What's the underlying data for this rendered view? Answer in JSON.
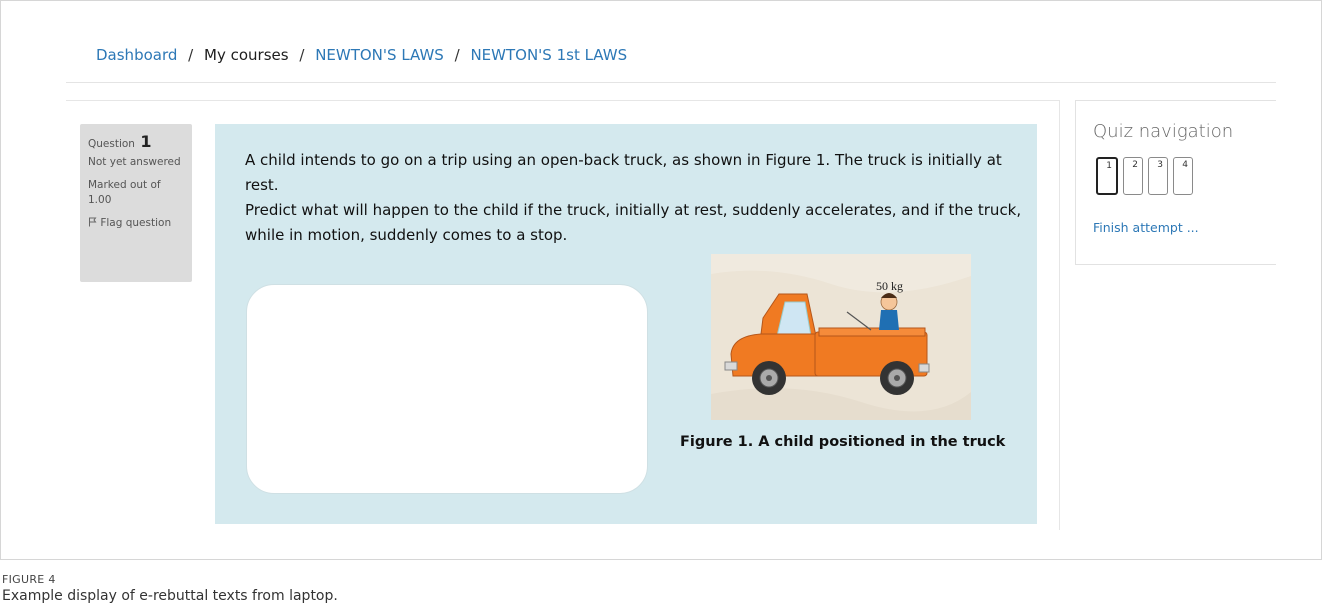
{
  "breadcrumb": {
    "items": [
      {
        "label": "Dashboard"
      },
      {
        "label": "My courses"
      },
      {
        "label": "NEWTON'S LAWS"
      },
      {
        "label": "NEWTON'S 1st LAWS"
      }
    ],
    "separator": "/"
  },
  "question_info": {
    "question_label": "Question",
    "question_number": "1",
    "state": "Not yet answered",
    "grade": "Marked out of 1.00",
    "flag_label": "Flag question",
    "flag_icon": "flag-icon"
  },
  "question": {
    "text_line1": "A child intends to go on a trip using an open-back truck, as shown in Figure 1. The truck is initially at rest.",
    "text_line2": "Predict what will happen to the child if the truck, initially at rest, suddenly accelerates, and if the truck, while in motion, suddenly comes to a stop.",
    "figure_mass_label": "50 kg",
    "figure_caption": "Figure 1.  A child positioned in the truck"
  },
  "quiz_nav": {
    "title": "Quiz navigation",
    "buttons": [
      "1",
      "2",
      "3",
      "4"
    ],
    "finish_label": "Finish attempt ..."
  },
  "caption": {
    "label": "FIGURE 4",
    "description": "Example display of e-rebuttal texts from laptop."
  },
  "colors": {
    "link": "#2d78b6",
    "question_bg": "#d4e9ee",
    "info_bg": "#dcdcdc",
    "truck": "#f07a22"
  }
}
